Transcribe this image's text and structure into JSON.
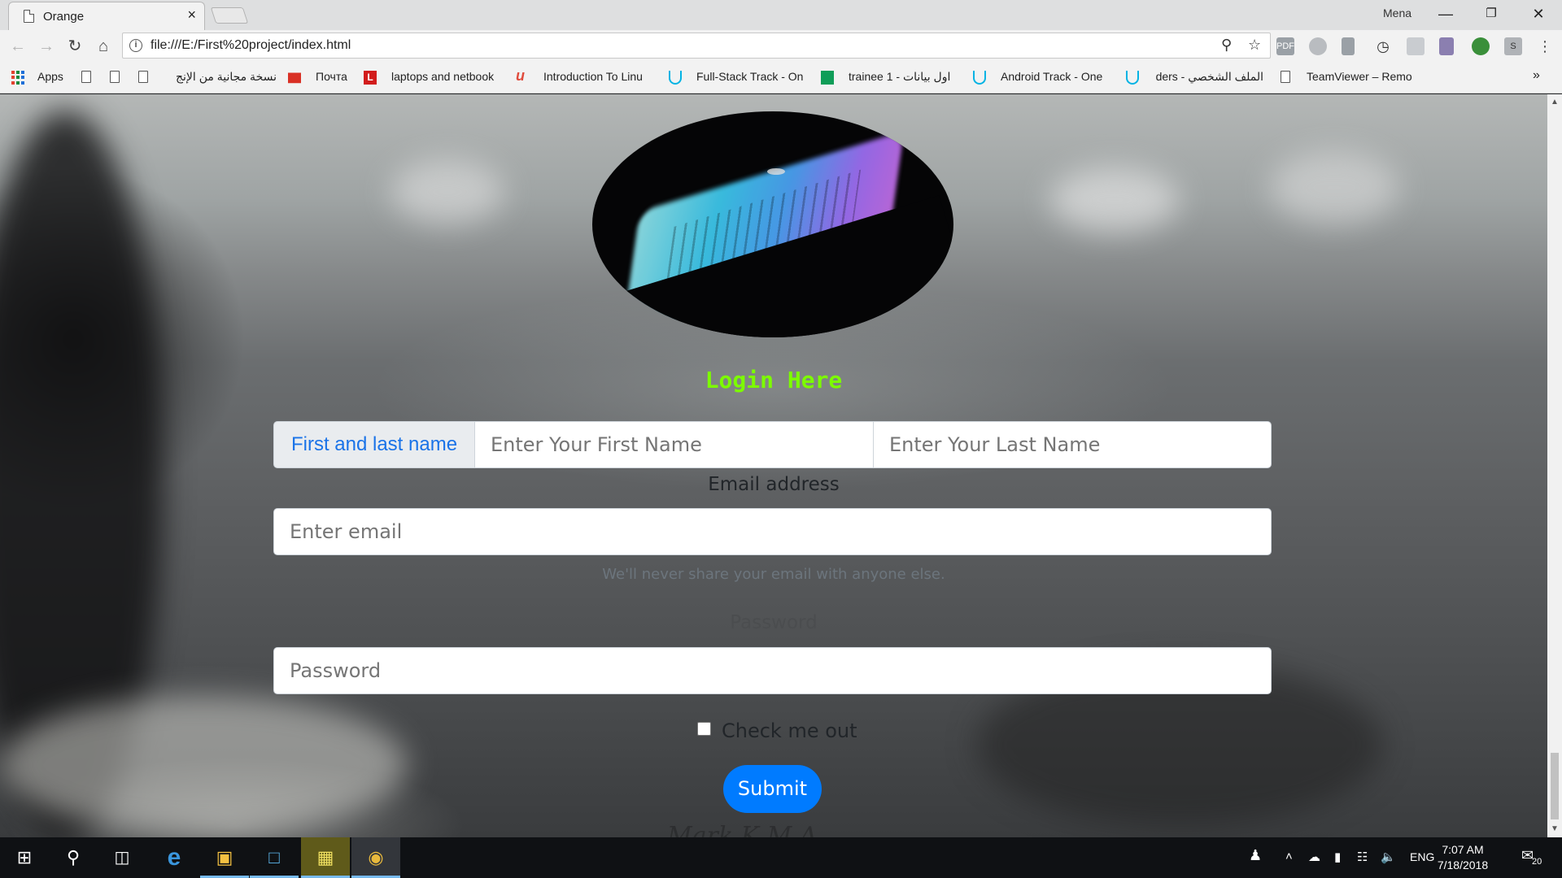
{
  "browser": {
    "tab_title": "Orange",
    "tab_close": "×",
    "user": "Mena",
    "url": "file:///E:/First%20project/index.html",
    "bookmarks": [
      {
        "label": "Apps",
        "icon": "apps-icon"
      },
      {
        "label": "",
        "icon": "page-icon"
      },
      {
        "label": "",
        "icon": "page-icon"
      },
      {
        "label": "نسخة مجانية من الإنج",
        "icon": "page-icon"
      },
      {
        "label": "Почта",
        "icon": "mail-icon"
      },
      {
        "label": "laptops and netbook",
        "icon": "l-icon"
      },
      {
        "label": "Introduction To Linu",
        "icon": "u-icon"
      },
      {
        "label": "Full-Stack Track - On",
        "icon": "udacity-icon"
      },
      {
        "label": "trainee 1 - اول بيانات",
        "icon": "sheets-icon"
      },
      {
        "label": "Android Track - One",
        "icon": "udacity-icon"
      },
      {
        "label": "الملف الشخصي - ders",
        "icon": "udacity-icon"
      },
      {
        "label": "TeamViewer – Remo",
        "icon": "page-icon"
      }
    ],
    "more_bookmarks": "»",
    "accent": "#1a73e8"
  },
  "page": {
    "title": "Login Here",
    "name_prepend": "First and last name",
    "first_name_placeholder": "Enter Your First Name",
    "last_name_placeholder": "Enter Your Last Name",
    "email_label": "Email address",
    "email_placeholder": "Enter email",
    "email_help": "We'll never share your email with anyone else.",
    "password_label": "Password",
    "password_placeholder": "Password",
    "checkbox_label": "Check me out",
    "submit_label": "Submit",
    "title_color": "#7cfc00",
    "button_color": "#007bff"
  },
  "taskbar": {
    "language": "ENG",
    "time": "7:07 AM",
    "date": "7/18/2018",
    "notifications": "20"
  }
}
